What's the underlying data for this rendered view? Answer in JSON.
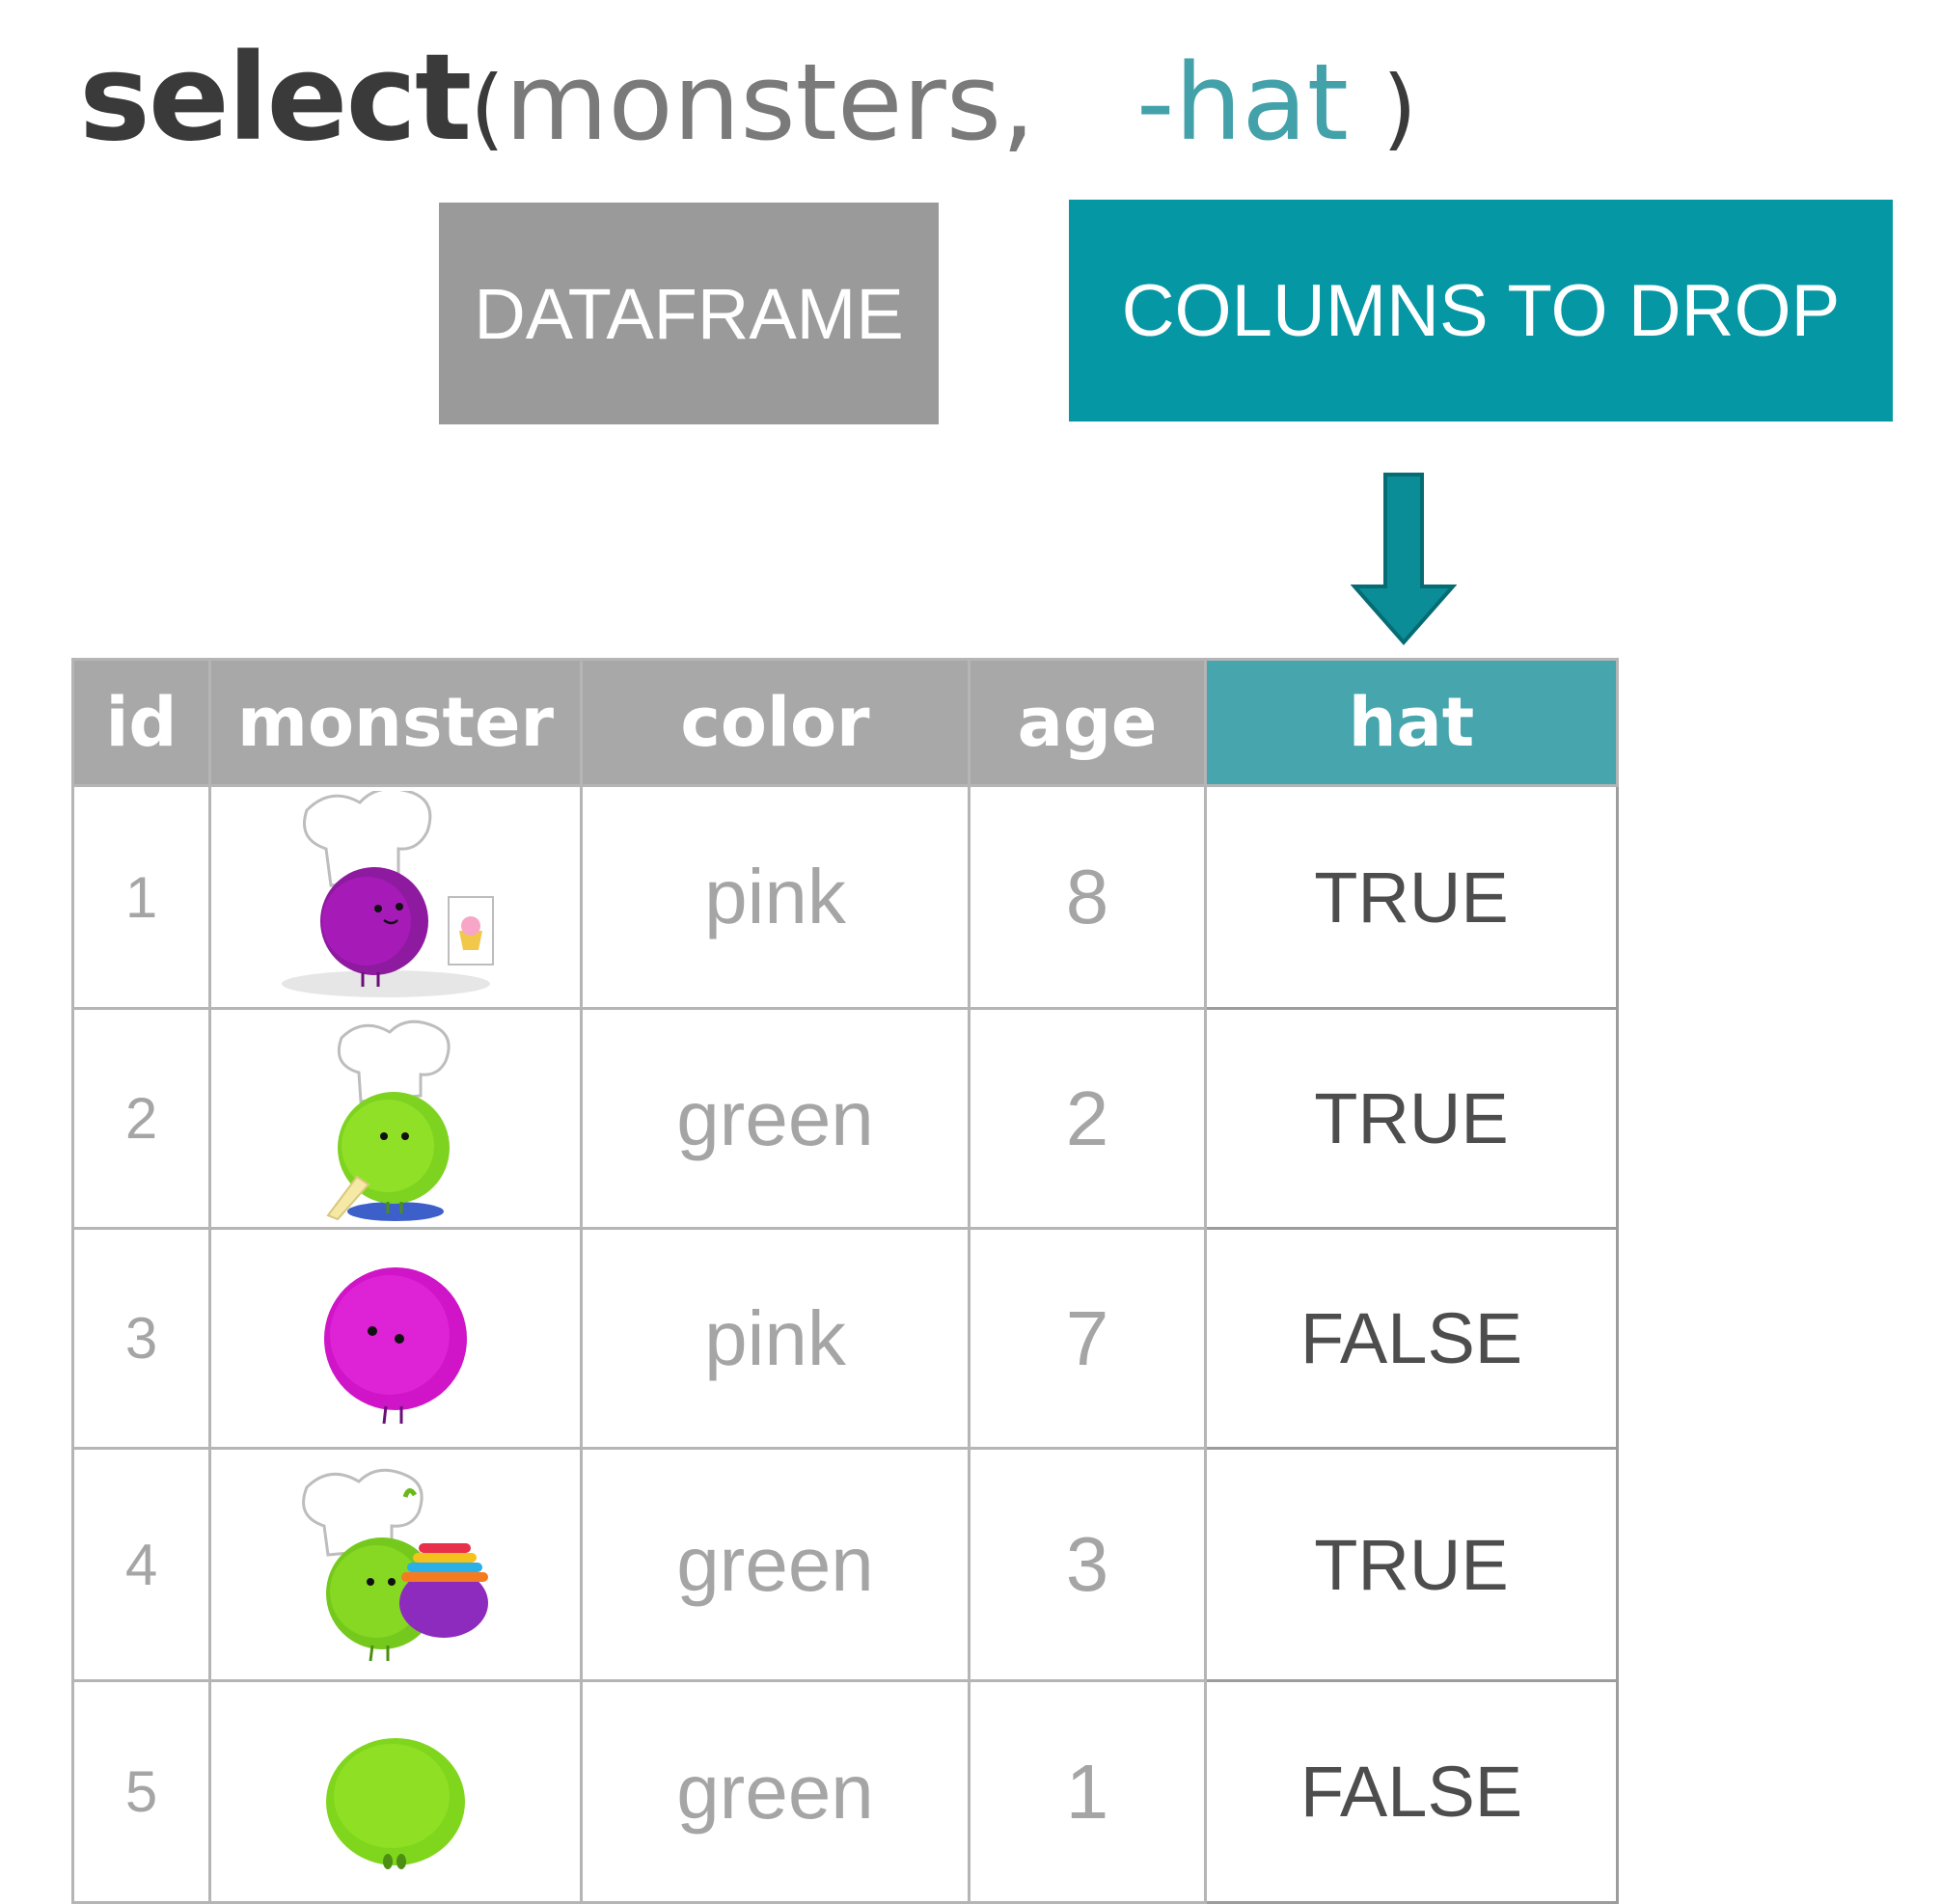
{
  "code": {
    "function": "select",
    "open_paren": "(",
    "dataframe_arg": "monsters,",
    "drop_arg": "-hat",
    "close_paren": ")"
  },
  "labels": {
    "dataframe": "DATAFRAME",
    "columns_to_drop": "COLUMNS TO DROP"
  },
  "colors": {
    "accent_teal": "#0597a4",
    "header_teal": "#46a5ad",
    "header_gray": "#a8a8a8",
    "dataframe_box": "#9a9a9a"
  },
  "table": {
    "headers": [
      "id",
      "monster",
      "color",
      "age",
      "hat"
    ],
    "rows": [
      {
        "id": "1",
        "monster": "purple-chef-monster-icon",
        "color": "pink",
        "age": "8",
        "hat": "TRUE"
      },
      {
        "id": "2",
        "monster": "green-chef-monster-icon",
        "color": "green",
        "age": "2",
        "hat": "TRUE"
      },
      {
        "id": "3",
        "monster": "purple-monster-icon",
        "color": "pink",
        "age": "7",
        "hat": "FALSE"
      },
      {
        "id": "4",
        "monster": "green-chef-bowls-monster-icon",
        "color": "green",
        "age": "3",
        "hat": "TRUE"
      },
      {
        "id": "5",
        "monster": "green-monster-icon",
        "color": "green",
        "age": "1",
        "hat": "FALSE"
      }
    ]
  }
}
